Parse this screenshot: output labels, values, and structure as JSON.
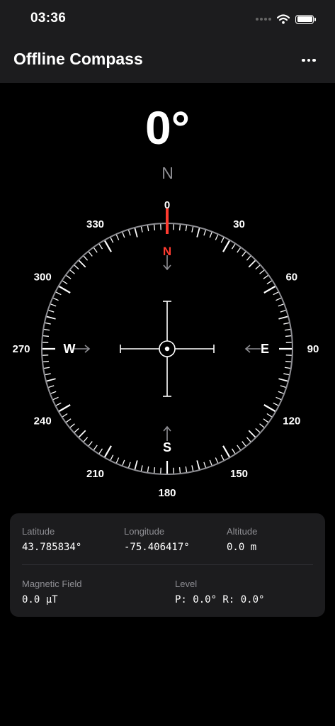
{
  "status_bar": {
    "time": "03:36"
  },
  "nav": {
    "title": "Offline Compass"
  },
  "compass": {
    "heading": "0°",
    "direction": "N",
    "degree_labels": [
      "0",
      "30",
      "60",
      "90",
      "120",
      "150",
      "180",
      "210",
      "240",
      "270",
      "300",
      "330"
    ],
    "cardinals": {
      "north": "N",
      "east": "E",
      "south": "S",
      "west": "W"
    },
    "accent_color": "#ff3b30"
  },
  "info": {
    "latitude_label": "Latitude",
    "latitude_value": "43.785834°",
    "longitude_label": "Longitude",
    "longitude_value": "-75.406417°",
    "altitude_label": "Altitude",
    "altitude_value": "0.0 m",
    "magnetic_label": "Magnetic Field",
    "magnetic_value": "0.0 µT",
    "level_label": "Level",
    "level_value": "P: 0.0° R: 0.0°"
  }
}
